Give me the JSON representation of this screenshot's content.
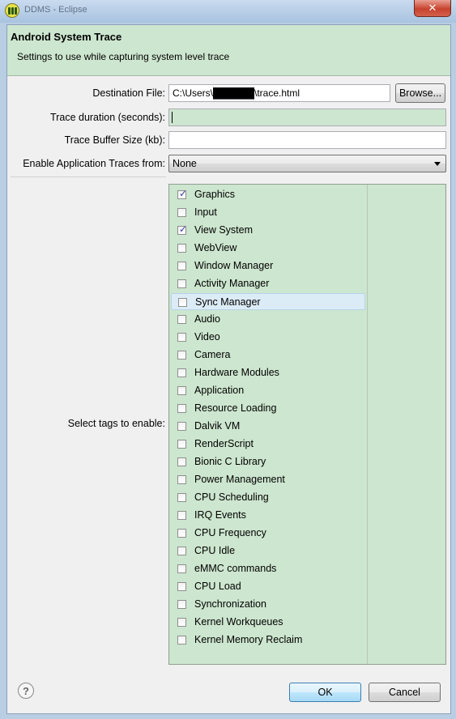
{
  "window": {
    "title": "DDMS - Eclipse",
    "close_glyph": "✕",
    "app_icon": "eclipse-app-icon"
  },
  "header": {
    "title": "Android System Trace",
    "description": "Settings to use while capturing system level trace"
  },
  "form": {
    "destination_label": "Destination File:",
    "destination_value": "C:\\Users\\██████\\trace.html",
    "browse_label": "Browse...",
    "duration_label": "Trace duration (seconds):",
    "duration_value": "",
    "buffer_label": "Trace Buffer Size (kb):",
    "buffer_value": "",
    "app_traces_label": "Enable Application Traces from:",
    "app_traces_value": "None",
    "tags_label": "Select tags to enable:"
  },
  "tags": [
    {
      "label": "Graphics",
      "checked": true
    },
    {
      "label": "Input",
      "checked": false
    },
    {
      "label": "View System",
      "checked": true
    },
    {
      "label": "WebView",
      "checked": false
    },
    {
      "label": "Window Manager",
      "checked": false
    },
    {
      "label": "Activity Manager",
      "checked": false
    },
    {
      "label": "Sync Manager",
      "checked": false,
      "highlighted": true
    },
    {
      "label": "Audio",
      "checked": false
    },
    {
      "label": "Video",
      "checked": false
    },
    {
      "label": "Camera",
      "checked": false
    },
    {
      "label": "Hardware Modules",
      "checked": false
    },
    {
      "label": "Application",
      "checked": false
    },
    {
      "label": "Resource Loading",
      "checked": false
    },
    {
      "label": "Dalvik VM",
      "checked": false
    },
    {
      "label": "RenderScript",
      "checked": false
    },
    {
      "label": "Bionic C Library",
      "checked": false
    },
    {
      "label": "Power Management",
      "checked": false
    },
    {
      "label": "CPU Scheduling",
      "checked": false
    },
    {
      "label": "IRQ Events",
      "checked": false
    },
    {
      "label": "CPU Frequency",
      "checked": false
    },
    {
      "label": "CPU Idle",
      "checked": false
    },
    {
      "label": "eMMC commands",
      "checked": false
    },
    {
      "label": "CPU Load",
      "checked": false
    },
    {
      "label": "Synchronization",
      "checked": false
    },
    {
      "label": "Kernel Workqueues",
      "checked": false
    },
    {
      "label": "Kernel Memory Reclaim",
      "checked": false
    }
  ],
  "footer": {
    "help_glyph": "?",
    "ok_label": "OK",
    "cancel_label": "Cancel"
  },
  "colors": {
    "header_bg": "#cde6cf",
    "highlight": "#dcecf7"
  }
}
